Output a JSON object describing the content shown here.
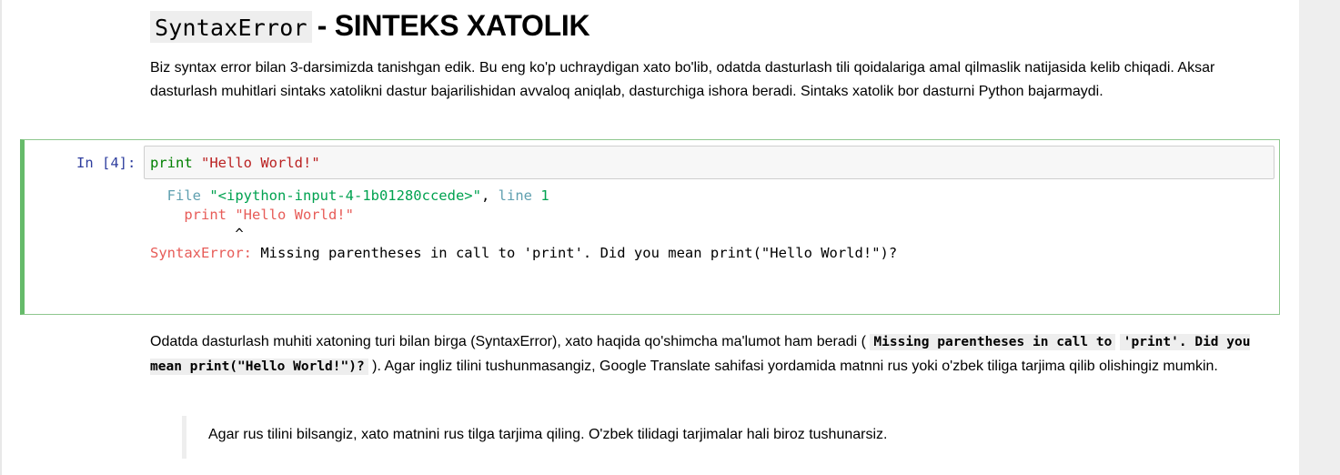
{
  "heading": {
    "code": "SyntaxError",
    "text": "- SINTEKS XATOLIK"
  },
  "intro_paragraph": "Biz syntax error bilan 3-darsimizda tanishgan edik. Bu eng ko'p uchraydigan xato bo'lib, odatda dasturlash tili qoidalariga amal qilmaslik natijasida kelib chiqadi. Aksar dasturlash muhitlari sintaks xatolikni dastur bajarilishidan avvaloq aniqlab, dasturchiga ishora beradi. Sintaks xatolik bor dasturni Python bajarmaydi.",
  "cell": {
    "prompt": "In [4]:",
    "input_keyword": "print",
    "input_string": "\"Hello World!\"",
    "output": {
      "file_label": "File",
      "file_name": "\"<ipython-input-4-1b01280ccede>\"",
      "comma": ",",
      "line_label": "line",
      "line_number": "1",
      "code_line": "print \"Hello World!\"",
      "caret": "^",
      "error_type": "SyntaxError:",
      "error_message": "Missing parentheses in call to 'print'. Did you mean print(\"Hello World!\")?"
    }
  },
  "explain_paragraph": {
    "before": "Odatda dasturlash muhiti xatoning turi bilan birga (SyntaxError), xato haqida qo'shimcha ma'lumot ham beradi (",
    "code_part1": "Missing parentheses in call to",
    "code_part2": "'print'. Did you mean print(\"Hello World!\")?",
    "after": "). Agar ingliz tilini tushunmasangiz, Google Translate sahifasi yordamida matnni rus yoki o'zbek tiliga tarjima qilib olishingiz mumkin."
  },
  "blockquote": "Agar rus tilini bilsangiz, xato matnini rus tilga tarjima qiling. O'zbek tilidagi tarjimalar hali biroz tushunarsiz.",
  "colors": {
    "cell_border": "#66bb6a",
    "prompt": "#303f9f",
    "error_red": "#e75c58"
  }
}
